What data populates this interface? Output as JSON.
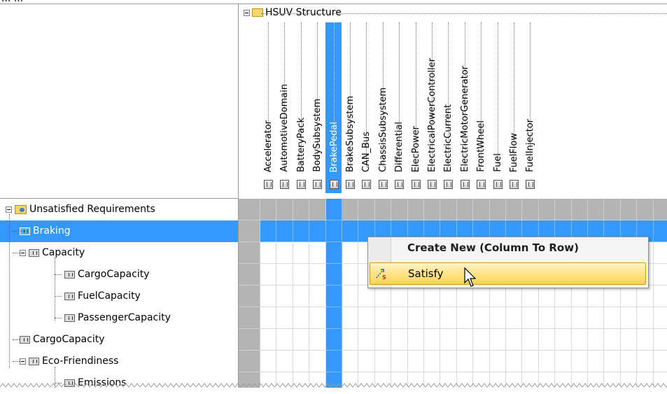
{
  "header": {
    "top_text": "... ...",
    "structure_title": "HSUV Structure"
  },
  "columns": [
    {
      "label": "Accelerator",
      "selected": false
    },
    {
      "label": "AutomotiveDomain",
      "selected": false
    },
    {
      "label": "BatteryPack",
      "selected": false
    },
    {
      "label": "BodySubsystem",
      "selected": false
    },
    {
      "label": "BrakePedal",
      "selected": true
    },
    {
      "label": "BrakeSubsystem",
      "selected": false
    },
    {
      "label": "CAN_Bus",
      "selected": false
    },
    {
      "label": "ChassisSubsystem",
      "selected": false
    },
    {
      "label": "Differential",
      "selected": false
    },
    {
      "label": "ElecPower",
      "selected": false
    },
    {
      "label": "ElectricalPowerController",
      "selected": false
    },
    {
      "label": "ElectricCurrent",
      "selected": false
    },
    {
      "label": "ElectricMotorGenerator",
      "selected": false
    },
    {
      "label": "FrontWheel",
      "selected": false
    },
    {
      "label": "Fuel",
      "selected": false
    },
    {
      "label": "FuelFlow",
      "selected": false
    },
    {
      "label": "FuelInjector",
      "selected": false
    }
  ],
  "rows": [
    {
      "label": "Unsatisfied Requirements",
      "kind": "package",
      "selected": false
    },
    {
      "label": "Braking",
      "kind": "requirement",
      "selected": true
    },
    {
      "label": "Capacity",
      "kind": "requirement",
      "selected": false
    },
    {
      "label": "CargoCapacity",
      "kind": "requirement",
      "selected": false
    },
    {
      "label": "FuelCapacity",
      "kind": "requirement",
      "selected": false
    },
    {
      "label": "PassengerCapacity",
      "kind": "requirement",
      "selected": false
    },
    {
      "label": "CargoCapacity",
      "kind": "requirement",
      "selected": false
    },
    {
      "label": "Eco-Friendiness",
      "kind": "requirement",
      "selected": false
    },
    {
      "label": "Emissions",
      "kind": "requirement",
      "selected": false
    }
  ],
  "context_menu": {
    "header": "Create New (Column To Row)",
    "items": [
      {
        "label": "Satisfy",
        "icon": "satisfy-icon"
      }
    ]
  },
  "colors": {
    "selection": "#3399ff",
    "menu_highlight": "#ffd54d",
    "grid_gray": "#b4b4b4"
  }
}
